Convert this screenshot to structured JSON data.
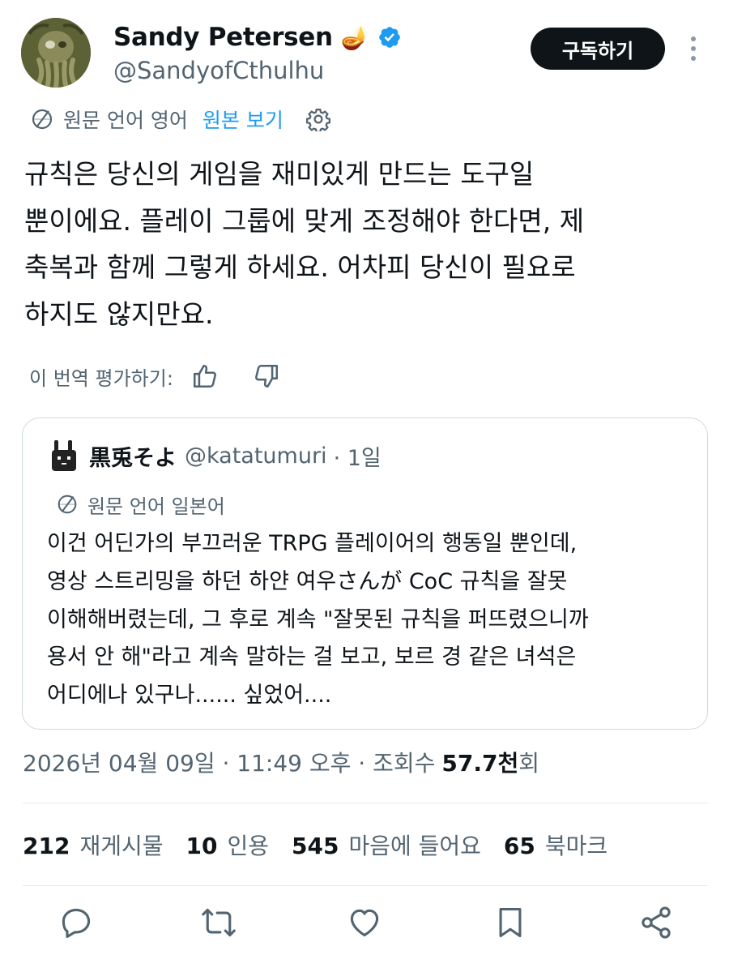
{
  "author": {
    "display_name": "Sandy Petersen",
    "handle": "@SandyofCthulhu",
    "badge_emoji": "🪔"
  },
  "subscribe_label": "구독하기",
  "translation": {
    "source_label": "원문 언어 영어",
    "show_original": "원본 보기"
  },
  "tweet_text": "규칙은 당신의 게임을 재미있게 만드는 도구일 뿐이에요. 플레이 그룹에 맞게 조정해야 한다면, 제 축복과 함께 그렇게 하세요. 어차피 당신이 필요로 하지도 않지만요.",
  "tweet_lines": [
    "규칙은 당신의 게임을 재미있게 만드는 도구일",
    "뿐이에요. 플레이 그룹에 맞게 조정해야 한다면, 제",
    "축복과 함께 그렇게 하세요. 어차피 당신이 필요로",
    "하지도 않지만요."
  ],
  "rate_label": "이 번역 평가하기:",
  "quote": {
    "name": "黒兎そよ",
    "handle": "@katatumuri",
    "time": "· 1일",
    "translation_label": "원문 언어 일본어",
    "lines": [
      "이건 어딘가의 부끄러운 TRPG 플레이어의 행동일 뿐인데,",
      "영상 스트리밍을 하던 하얀 여우さんが CoC 규칙을 잘못",
      "이해해버렸는데, 그 후로 계속 \"잘못된 규칙을 퍼뜨렸으니까",
      "용서 안 해\"라고 계속 말하는 걸 보고, 보르 경 같은 녀석은",
      "어디에나 있구나...... 싶었어...."
    ]
  },
  "meta": {
    "date": "2026년 04월 09일 · 11:49 오후 · 조회수",
    "views": "57.7천",
    "views_suffix": "회"
  },
  "stats": [
    {
      "num": "212",
      "label": "재게시물"
    },
    {
      "num": "10",
      "label": "인용"
    },
    {
      "num": "545",
      "label": "마음에 들어요"
    },
    {
      "num": "65",
      "label": "북마크"
    }
  ],
  "colors": {
    "text": "#0f1419",
    "secondary": "#536471",
    "link": "#1d9bf0",
    "verified": "#1d9bf0",
    "border": "#cfd9de"
  }
}
